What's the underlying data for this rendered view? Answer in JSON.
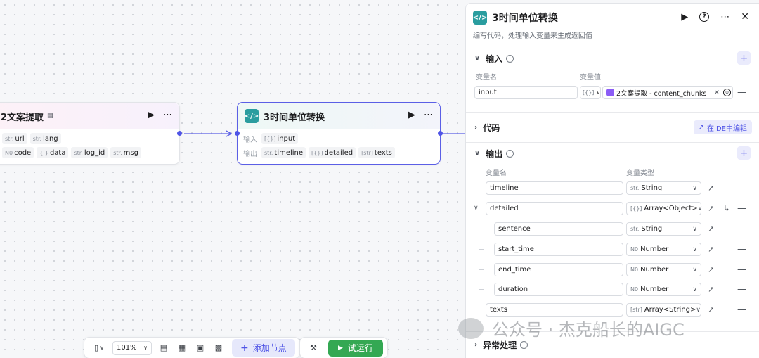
{
  "node_left": {
    "title": "2文案提取",
    "tags_row1": [
      {
        "type": "str.",
        "name": "url"
      },
      {
        "type": "str.",
        "name": "lang"
      }
    ],
    "tags_row2": [
      {
        "type": "N0",
        "name": "code"
      },
      {
        "type": "{ }",
        "name": "data"
      },
      {
        "type": "str.",
        "name": "log_id"
      },
      {
        "type": "str.",
        "name": "msg"
      }
    ]
  },
  "node_center": {
    "icon": "</>",
    "title": "3时间单位转换",
    "input_label": "输入",
    "output_label": "输出",
    "inputs": [
      {
        "type": "[{}]",
        "name": "input"
      }
    ],
    "outputs": [
      {
        "type": "str.",
        "name": "timeline"
      },
      {
        "type": "[{}]",
        "name": "detailed"
      },
      {
        "type": "[str]",
        "name": "texts"
      }
    ]
  },
  "panel": {
    "icon": "</>",
    "title": "3时间单位转换",
    "description": "编写代码，处理输入变量来生成返回值",
    "input_section": {
      "title": "输入",
      "col_name": "变量名",
      "col_value": "变量值",
      "row": {
        "name": "input",
        "type_icon": "[{}]",
        "ref": "2文案提取 - content_chunks"
      }
    },
    "code_section": {
      "title": "代码",
      "ide_button": "在IDE中编辑"
    },
    "output_section": {
      "title": "输出",
      "col_name": "变量名",
      "col_type": "变量类型",
      "rows": [
        {
          "name": "timeline",
          "type_prefix": "str.",
          "type": "String",
          "level": 0
        },
        {
          "name": "detailed",
          "type_prefix": "[{}]",
          "type": "Array<Object>",
          "level": 0,
          "expandable": true
        },
        {
          "name": "sentence",
          "type_prefix": "str.",
          "type": "String",
          "level": 1
        },
        {
          "name": "start_time",
          "type_prefix": "N0",
          "type": "Number",
          "level": 1
        },
        {
          "name": "end_time",
          "type_prefix": "N0",
          "type": "Number",
          "level": 1
        },
        {
          "name": "duration",
          "type_prefix": "N0",
          "type": "Number",
          "level": 1
        },
        {
          "name": "texts",
          "type_prefix": "[str]",
          "type": "Array<String>",
          "level": 0
        }
      ]
    },
    "exception_section": {
      "title": "异常处理"
    }
  },
  "toolbar": {
    "zoom": "101%",
    "add_node": "添加节点",
    "run": "试运行"
  },
  "watermark": "公众号 · 杰克船长的AIGC",
  "colors": {
    "accent": "#4f54e6",
    "run_green": "#34a853",
    "code_icon": "#2a9d9f"
  }
}
